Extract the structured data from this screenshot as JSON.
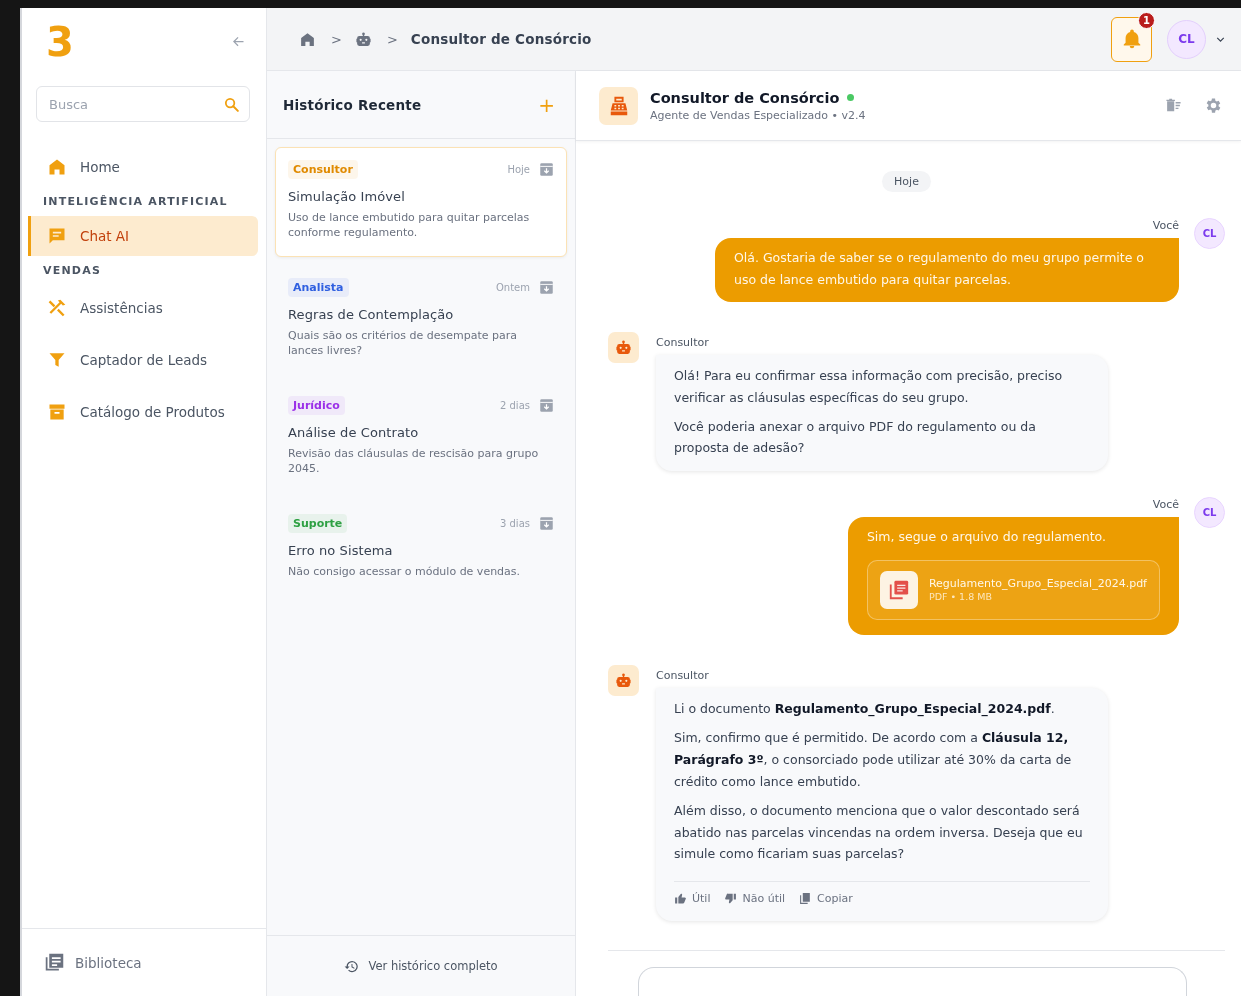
{
  "sidebar": {
    "logo": "3",
    "search": {
      "placeholder": "Busca"
    },
    "items": [
      {
        "kind": "link",
        "label": "Home",
        "selected": false
      },
      {
        "kind": "section",
        "label": "INTELIGÊNCIA ARTIFICIAL"
      },
      {
        "kind": "link",
        "label": "Chat AI",
        "selected": true
      },
      {
        "kind": "section",
        "label": "VENDAS"
      },
      {
        "kind": "link",
        "label": "Assistências",
        "selected": false
      },
      {
        "kind": "link",
        "label": "Captador de Leads",
        "selected": false
      },
      {
        "kind": "link",
        "label": "Catálogo de Produtos",
        "selected": false
      }
    ],
    "footer": {
      "label": "Biblioteca"
    }
  },
  "breadcrumb": [
    {
      "kind": "home"
    },
    {
      "kind": "separator",
      "text": ">"
    },
    {
      "kind": "agent"
    },
    {
      "kind": "separator",
      "text": ">"
    },
    {
      "kind": "current",
      "text": "Consultor de Consórcio"
    }
  ],
  "topbar": {
    "notifications": {
      "count": "1"
    },
    "user": {
      "initials": "CL"
    }
  },
  "history": {
    "title": "Histórico Recente",
    "add": "+",
    "conversations": [
      {
        "tag": "Consultor",
        "color": "#e08a00",
        "time": "Hoje",
        "title": "Simulação Imóvel",
        "snippet": "Uso de lance embutido para quitar parcelas conforme regulamento.",
        "selected": true
      },
      {
        "tag": "Analista",
        "color": "#2f5fe0",
        "time": "Ontem",
        "title": "Regras de Contemplação",
        "snippet": "Quais são os critérios de desempate para lances livres?",
        "selected": false
      },
      {
        "tag": "Jurídico",
        "color": "#9b30e8",
        "time": "2 dias",
        "title": "Análise de Contrato",
        "snippet": "Revisão das cláusulas de rescisão para grupo 2045.",
        "selected": false
      },
      {
        "tag": "Suporte",
        "color": "#2ea043",
        "time": "3 dias",
        "title": "Erro no Sistema",
        "snippet": "Não consigo acessar o módulo de vendas.",
        "selected": false
      }
    ],
    "footer": "Ver histórico completo"
  },
  "chat": {
    "header": {
      "title": "Consultor de Consórcio",
      "online": true,
      "subtitle": "Agente de Vendas Especializado • v2.4"
    },
    "date": "Hoje",
    "messages": [
      {
        "kind": "user",
        "author": "Você",
        "avatar": "CL",
        "paragraphs": [
          "Olá. Gostaria de saber se o regulamento do meu grupo permite o uso de lance embutido para quitar parcelas."
        ]
      },
      {
        "kind": "bot",
        "author": "Consultor",
        "paragraphs": [
          "Olá! Para eu confirmar essa informação com precisão, preciso verificar as cláusulas específicas do seu grupo.",
          "Você poderia anexar o arquivo PDF do regulamento ou da proposta de adesão?"
        ]
      },
      {
        "kind": "user",
        "author": "Você",
        "avatar": "CL",
        "paragraphs": [
          "Sim, segue o arquivo do regulamento."
        ],
        "attachment": {
          "name": "Regulamento_Grupo_Especial_2024.pdf",
          "meta": "PDF • 1.8 MB"
        }
      },
      {
        "kind": "bot",
        "author": "Consultor",
        "paragraphs": [
          "Li o documento **Regulamento_Grupo_Especial_2024.pdf**.",
          "Sim, confirmo que é permitido. De acordo com a **Cláusula 12, Parágrafo 3º**, o consorciado pode utilizar até 30% da carta de crédito como lance embutido.",
          "Além disso, o documento menciona que o valor descontado será abatido nas parcelas vincendas na ordem inversa. Deseja que eu simule como ficariam suas parcelas?"
        ],
        "actions": [
          {
            "kind": "like",
            "label": "Útil"
          },
          {
            "kind": "dislike",
            "label": "Não útil"
          },
          {
            "kind": "copy",
            "label": "Copiar"
          }
        ]
      }
    ]
  }
}
